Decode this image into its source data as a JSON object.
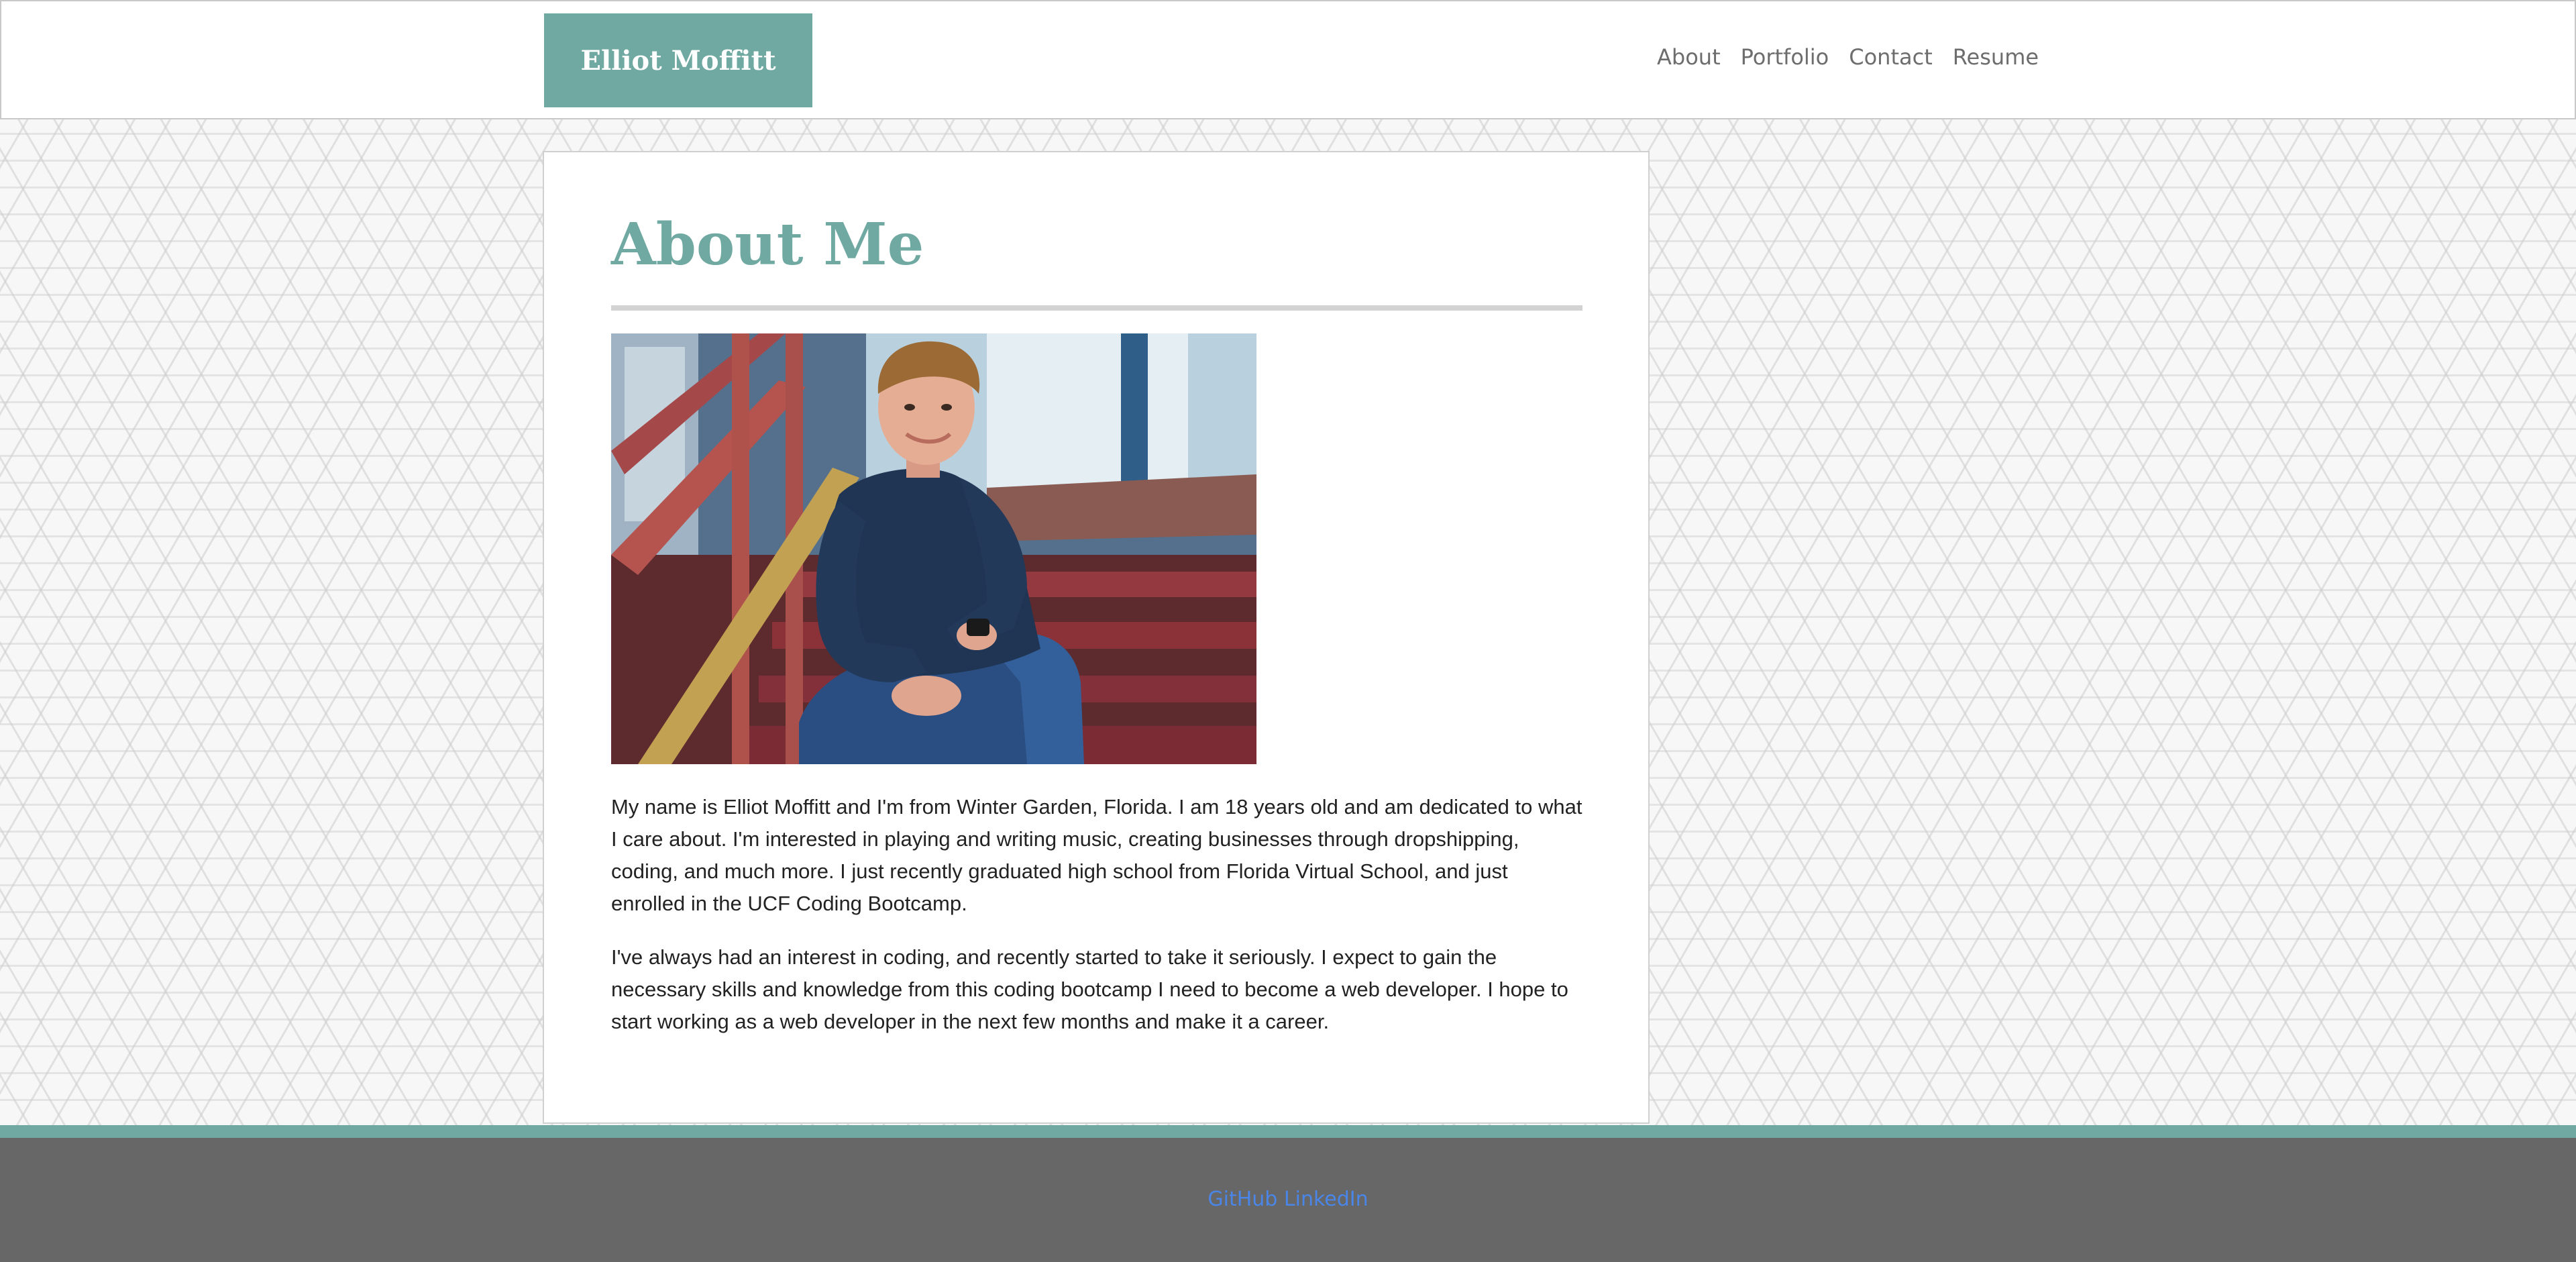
{
  "header": {
    "brand": "Elliot Moffitt",
    "nav": [
      "About",
      "Portfolio",
      "Contact",
      "Resume"
    ]
  },
  "main": {
    "title": "About Me",
    "paragraphs": [
      "My name is Elliot Moffitt and I'm from Winter Garden, Florida. I am 18 years old and am dedicated to what I care about. I'm interested in playing and writing music, creating businesses through dropshipping, coding, and much more. I just recently graduated high school from Florida Virtual School, and just enrolled in the UCF Coding Bootcamp.",
      "I've always had an interest in coding, and recently started to take it seriously. I expect to gain the necessary skills and knowledge from this coding bootcamp I need to become a web developer. I hope to start working as a web developer in the next few months and make it a career."
    ]
  },
  "footer": {
    "links": [
      "GitHub",
      "LinkedIn"
    ]
  },
  "colors": {
    "accent": "#6fa9a2",
    "footer_bg": "#676767",
    "link": "#4a86e8"
  }
}
